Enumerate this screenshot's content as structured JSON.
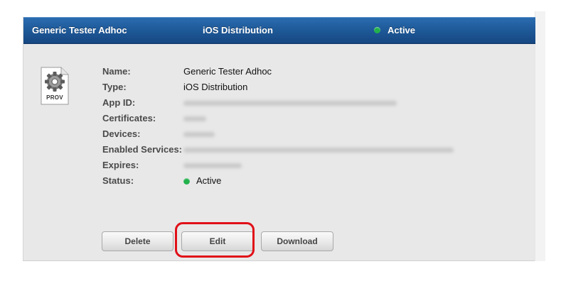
{
  "header": {
    "name": "Generic Tester Adhoc",
    "type": "iOS Distribution",
    "status": "Active"
  },
  "file_icon": {
    "icon": "provisioning-profile-gear-icon",
    "label": "PROV"
  },
  "details": {
    "labels": {
      "name": "Name:",
      "type": "Type:",
      "app_id": "App ID:",
      "certificates": "Certificates:",
      "devices": "Devices:",
      "enabled_services": "Enabled Services:",
      "expires": "Expires:",
      "status": "Status:"
    },
    "values": {
      "name": "Generic Tester Adhoc",
      "type": "iOS Distribution",
      "status": "Active"
    }
  },
  "buttons": {
    "delete": "Delete",
    "edit": "Edit",
    "download": "Download"
  },
  "colors": {
    "header_blue": "#1f5a9a",
    "active_green": "#22b14c",
    "highlight_red": "#e01018"
  }
}
